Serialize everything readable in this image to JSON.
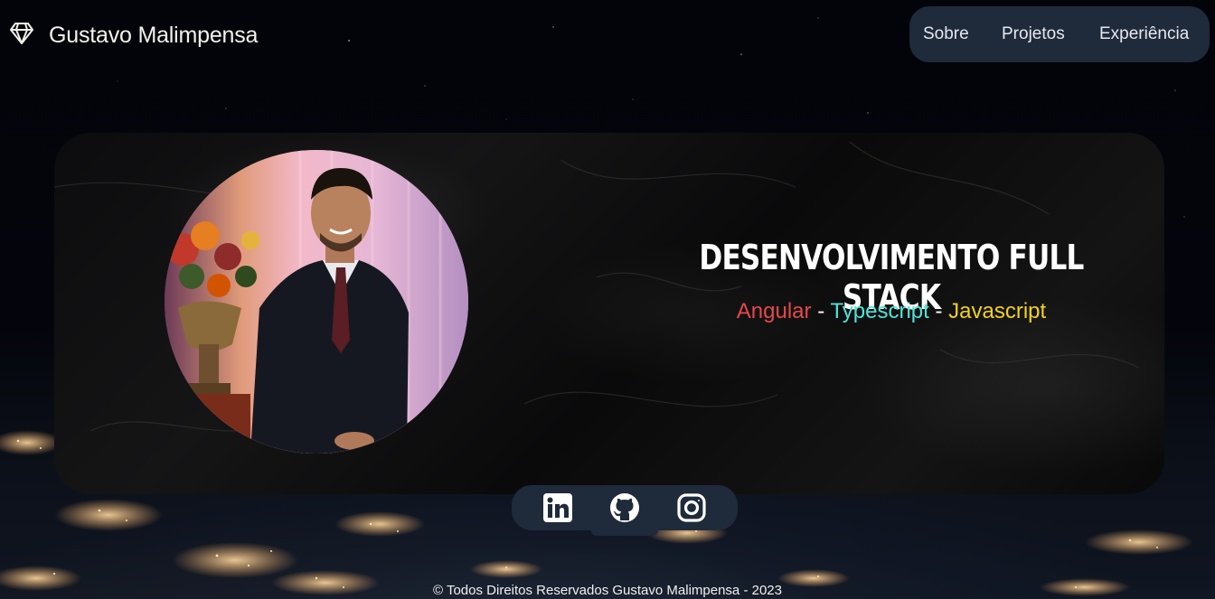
{
  "header": {
    "logo_icon": "diamond-icon",
    "brand_name": "Gustavo Malimpensa",
    "nav": [
      {
        "label": "Sobre"
      },
      {
        "label": "Projetos"
      },
      {
        "label": "Experiência"
      }
    ]
  },
  "hero": {
    "title": "Desenvolvimento Full Stack",
    "stack": [
      {
        "label": "Angular",
        "color": "#e8474a"
      },
      {
        "label": "Typescript",
        "color": "#4fe3d8"
      },
      {
        "label": "Javascript",
        "color": "#f4d21a"
      }
    ],
    "separator": "-",
    "photo_icon": "profile-photo"
  },
  "social": [
    {
      "name": "linkedin-icon"
    },
    {
      "name": "github-icon"
    },
    {
      "name": "instagram-icon"
    }
  ],
  "footer": {
    "text": "© Todos Direitos Reservados Gustavo Malimpensa - 2023"
  },
  "colors": {
    "nav_bg": "#1f2a3b",
    "page_bg": "#03040a"
  }
}
